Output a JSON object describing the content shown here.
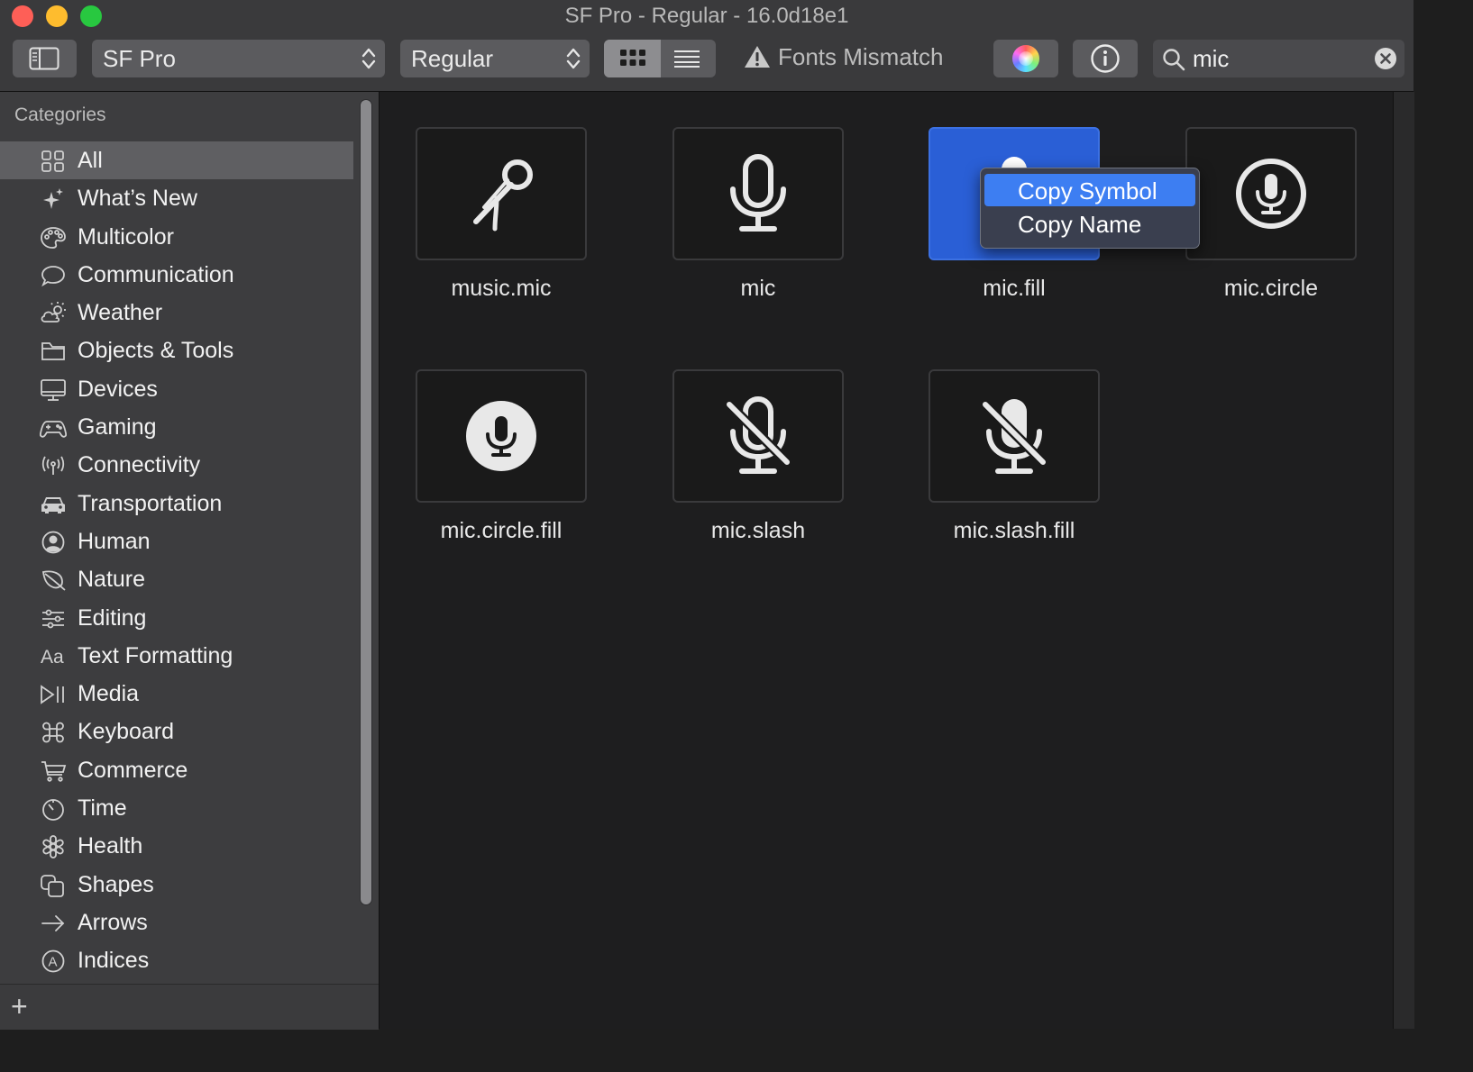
{
  "window": {
    "title": "SF Pro - Regular - 16.0d18e1"
  },
  "toolbar": {
    "font_value": "SF Pro",
    "weight_value": "Regular",
    "mismatch_label": "Fonts Mismatch",
    "search_value": "mic"
  },
  "sidebar": {
    "heading": "Categories",
    "items": [
      {
        "label": "All",
        "icon": "grid-icon"
      },
      {
        "label": "What’s New",
        "icon": "sparkles-icon"
      },
      {
        "label": "Multicolor",
        "icon": "palette-icon"
      },
      {
        "label": "Communication",
        "icon": "bubble-icon"
      },
      {
        "label": "Weather",
        "icon": "cloud-sun-icon"
      },
      {
        "label": "Objects & Tools",
        "icon": "folder-icon"
      },
      {
        "label": "Devices",
        "icon": "desktop-icon"
      },
      {
        "label": "Gaming",
        "icon": "gamecontroller-icon"
      },
      {
        "label": "Connectivity",
        "icon": "antenna-icon"
      },
      {
        "label": "Transportation",
        "icon": "car-icon"
      },
      {
        "label": "Human",
        "icon": "person-circle-icon"
      },
      {
        "label": "Nature",
        "icon": "leaf-icon"
      },
      {
        "label": "Editing",
        "icon": "sliders-icon"
      },
      {
        "label": "Text Formatting",
        "icon": "textformat-icon"
      },
      {
        "label": "Media",
        "icon": "playpause-icon"
      },
      {
        "label": "Keyboard",
        "icon": "command-icon"
      },
      {
        "label": "Commerce",
        "icon": "cart-icon"
      },
      {
        "label": "Time",
        "icon": "timer-icon"
      },
      {
        "label": "Health",
        "icon": "staroflife-icon"
      },
      {
        "label": "Shapes",
        "icon": "squares-icon"
      },
      {
        "label": "Arrows",
        "icon": "arrow-right-icon"
      },
      {
        "label": "Indices",
        "icon": "a-circle-icon"
      }
    ],
    "selected": "All"
  },
  "symbols": [
    {
      "name": "music.mic"
    },
    {
      "name": "mic"
    },
    {
      "name": "mic.fill"
    },
    {
      "name": "mic.circle"
    },
    {
      "name": "mic.circle.fill"
    },
    {
      "name": "mic.slash"
    },
    {
      "name": "mic.slash.fill"
    }
  ],
  "context_menu": {
    "items": [
      "Copy Symbol",
      "Copy Name"
    ],
    "highlighted": "Copy Symbol"
  },
  "colors": {
    "accent": "#2a5fd6",
    "menu_highlight": "#3d7ef2"
  }
}
